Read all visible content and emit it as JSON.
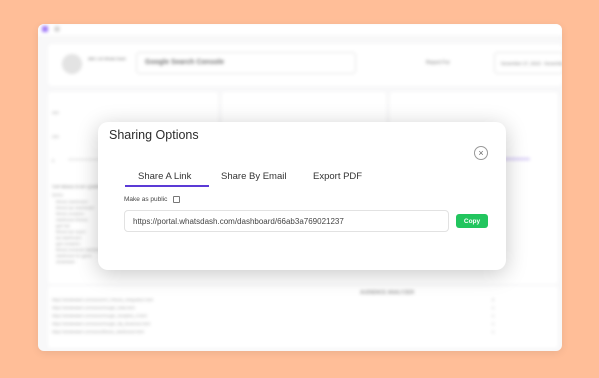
{
  "background": {
    "header": {
      "logo_text": "ABC Ltd Whats Dash",
      "property": "Google Search Console",
      "report_for_label": "Report For",
      "date_range": "November 27, 2023 - November"
    },
    "chart_y_ticks": [
      "400",
      "200",
      "0"
    ],
    "section_label": "TOP RESULTS BY QUERY",
    "query_label": "Query",
    "query_items": [
      "fitness dashboard",
      "fitness kpi dashboard",
      "fitness analytics",
      "dashboard fitness",
      "gym kpi",
      "fitness kpi report",
      "kpi dashboard",
      "gym analytics",
      "fitness business dashboard",
      "dashboard for gyms",
      "whatsdash"
    ],
    "audience_title": "AUDIENCE ANALYZER",
    "page_urls": [
      "https://whatsdash.com/docs/UX_Fitness_Integration.html",
      "https://whatsdash.com/docs/Google_Data.html",
      "https://whatsdash.com/docs/Google_Analytics_4.html",
      "https://whatsdash.com/docs/Google_My_Business.html",
      "https://whatsdash.com/docs/fitness_dashboard.html"
    ],
    "page_counts": [
      "2",
      "1",
      "1",
      "1",
      "1"
    ]
  },
  "modal": {
    "title": "Sharing Options",
    "close_icon": "×",
    "tabs": [
      {
        "label": "Share A Link",
        "active": true
      },
      {
        "label": "Share By Email",
        "active": false
      },
      {
        "label": "Export PDF",
        "active": false
      }
    ],
    "make_public_label": "Make as public",
    "make_public_checked": false,
    "share_url": "https://portal.whatsdash.com/dashboard/66ab3a769021237",
    "copy_label": "Copy",
    "colors": {
      "accent": "#5b3ad6",
      "copy_button": "#22c55e",
      "page_background": "#ffbe98"
    }
  }
}
